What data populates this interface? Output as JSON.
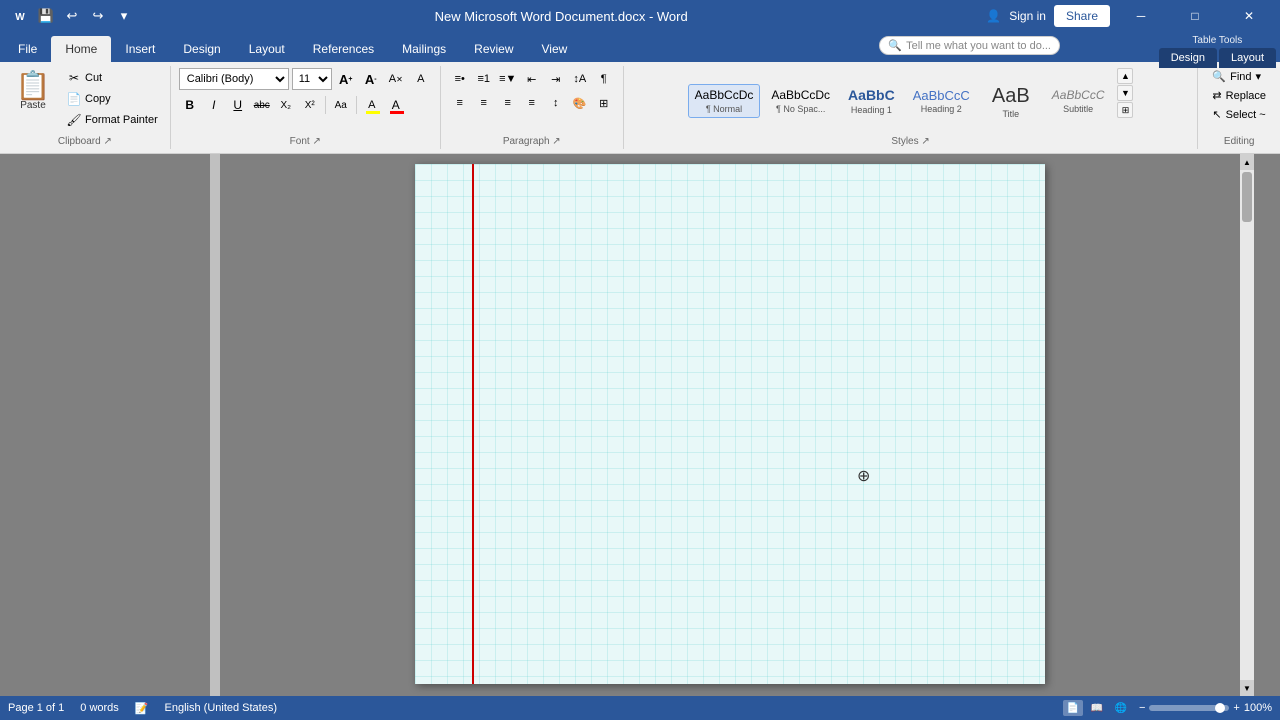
{
  "titlebar": {
    "title": "New Microsoft Word Document.docx - Word",
    "table_tools_label": "Table Tools",
    "quick_access": [
      "save",
      "undo",
      "redo",
      "more"
    ]
  },
  "ribbon_tabs": {
    "main_tabs": [
      "File",
      "Home",
      "Insert",
      "Design",
      "Layout",
      "References",
      "Mailings",
      "Review",
      "View"
    ],
    "active_tab": "Home",
    "table_design_tab": "Design",
    "table_layout_tab": "Layout"
  },
  "clipboard": {
    "paste_label": "Paste",
    "cut_label": "Cut",
    "copy_label": "Copy",
    "format_painter_label": "Format Painter"
  },
  "font": {
    "font_name": "Calibri (Body)",
    "font_size": "11",
    "increase_font_label": "A",
    "decrease_font_label": "A",
    "clear_format_label": "A",
    "bold_label": "B",
    "italic_label": "I",
    "underline_label": "U",
    "strikethrough_label": "abc",
    "subscript_label": "X₂",
    "superscript_label": "X²",
    "font_color_label": "A",
    "highlight_label": "A"
  },
  "paragraph": {
    "group_label": "Paragraph"
  },
  "styles": {
    "items": [
      {
        "id": "normal",
        "preview": "AaBbCcDc",
        "label": "Normal",
        "active": true
      },
      {
        "id": "no-space",
        "preview": "AaBbCcDc",
        "label": "No Spac...",
        "active": false
      },
      {
        "id": "heading1",
        "preview": "AaBbC",
        "label": "Heading 1",
        "active": false
      },
      {
        "id": "heading2",
        "preview": "AaBbCcC",
        "label": "Heading 2",
        "active": false
      },
      {
        "id": "title",
        "preview": "AaB",
        "label": "Title",
        "active": false
      },
      {
        "id": "subtitle",
        "preview": "AaBbCcC",
        "label": "Subtitle",
        "active": false
      }
    ],
    "group_label": "Styles"
  },
  "editing": {
    "find_label": "Find",
    "replace_label": "Replace",
    "select_label": "Select ~",
    "group_label": "Editing"
  },
  "tell_me": {
    "placeholder": "Tell me what you want to do..."
  },
  "status_bar": {
    "page_info": "Page 1 of 1",
    "word_count": "0 words",
    "language": "English (United States)",
    "zoom": "100%"
  },
  "document": {
    "grid_color": "#40c0c0",
    "grid_cell_size": 16,
    "red_line_color": "#cc0000"
  }
}
